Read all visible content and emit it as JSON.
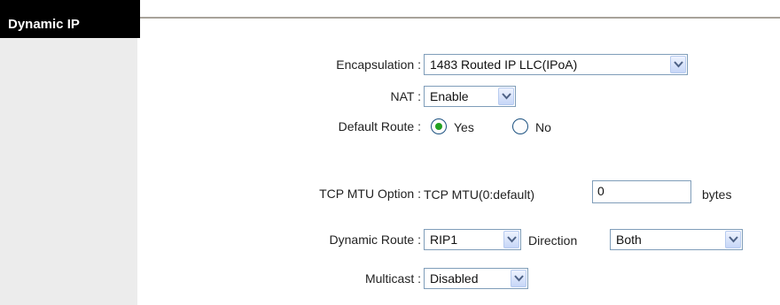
{
  "section": {
    "title": "Dynamic IP"
  },
  "form": {
    "encapsulation": {
      "label": "Encapsulation :",
      "value": "1483 Routed IP LLC(IPoA)"
    },
    "nat": {
      "label": "NAT :",
      "value": "Enable"
    },
    "default_route": {
      "label": "Default Route :",
      "options": [
        {
          "label": "Yes",
          "selected": true
        },
        {
          "label": "No",
          "selected": false
        }
      ]
    },
    "tcp_mtu": {
      "label": "TCP MTU Option :",
      "prefix": "TCP MTU(0:default)",
      "value": "0",
      "unit": "bytes"
    },
    "dynamic_route": {
      "label": "Dynamic Route :",
      "value": "RIP1",
      "direction_label": "Direction",
      "direction_value": "Both"
    },
    "multicast": {
      "label": "Multicast :",
      "value": "Disabled"
    }
  },
  "colors": {
    "tab_bg": "#000000",
    "side_panel": "#ececec",
    "radio_selected": "#21a121",
    "control_border": "#7f9db9"
  }
}
